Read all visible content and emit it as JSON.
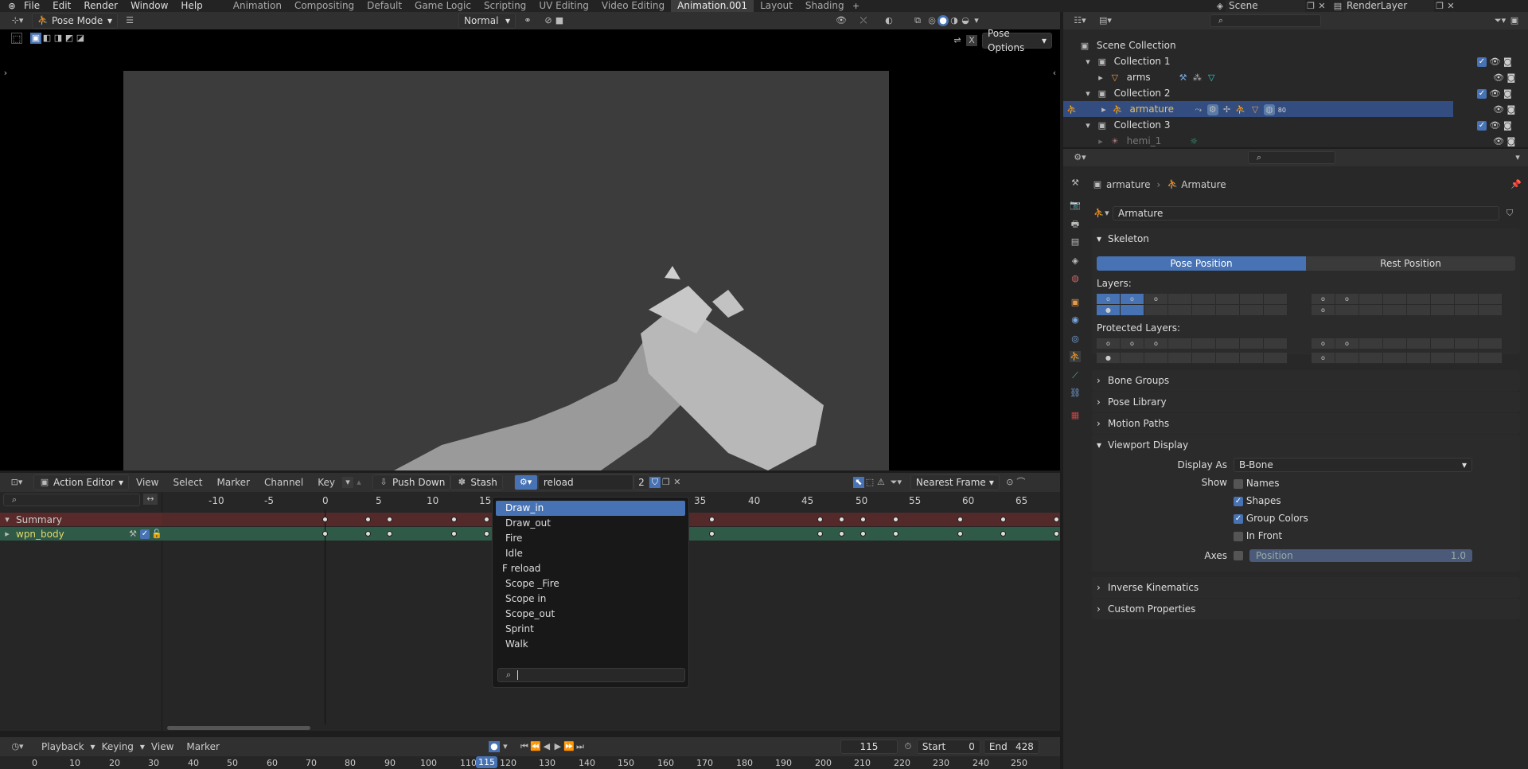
{
  "menu": {
    "items": [
      "File",
      "Edit",
      "Render",
      "Window",
      "Help"
    ]
  },
  "workspaces": {
    "tabs": [
      "Animation",
      "Compositing",
      "Default",
      "Game Logic",
      "Scripting",
      "UV Editing",
      "Video Editing",
      "Animation.001",
      "Layout",
      "Shading"
    ],
    "active": "Animation.001"
  },
  "scene": {
    "name": "Scene",
    "render_layer": "RenderLayer"
  },
  "viewport": {
    "mode": "Pose Mode",
    "transform": "Normal",
    "pose_options": "Pose Options"
  },
  "outliner": {
    "items": [
      {
        "label": "Scene Collection",
        "type": "scene"
      },
      {
        "label": "Collection 1",
        "type": "collection"
      },
      {
        "label": "arms",
        "type": "object"
      },
      {
        "label": "Collection 2",
        "type": "collection"
      },
      {
        "label": "armature",
        "type": "object",
        "selected": true
      },
      {
        "label": "Collection 3",
        "type": "collection"
      },
      {
        "label": "hemi_1",
        "type": "object",
        "dim": true
      }
    ],
    "badge": "80"
  },
  "properties": {
    "breadcrumb": {
      "object": "armature",
      "data": "Armature"
    },
    "datablock": "Armature",
    "skeleton": {
      "title": "Skeleton",
      "pose_position": "Pose Position",
      "rest_position": "Rest Position",
      "layers_label": "Layers:",
      "protected_label": "Protected Layers:"
    },
    "sections": [
      "Bone Groups",
      "Pose Library",
      "Motion Paths"
    ],
    "viewport_display": {
      "title": "Viewport Display",
      "display_as_label": "Display As",
      "display_as_value": "B-Bone",
      "show_label": "Show",
      "names": "Names",
      "shapes": "Shapes",
      "group_colors": "Group Colors",
      "in_front": "In Front",
      "axes_label": "Axes",
      "axes_field": "Position",
      "axes_value": "1.0"
    },
    "sections_bottom": [
      "Inverse Kinematics",
      "Custom Properties"
    ]
  },
  "action_editor": {
    "mode": "Action Editor",
    "menus": [
      "View",
      "Select",
      "Marker",
      "Channel",
      "Key"
    ],
    "push_down": "Push Down",
    "stash": "Stash",
    "action_name": "reload",
    "users": "2",
    "snap": "Nearest Frame",
    "ruler": [
      "-10",
      "-5",
      "0",
      "5",
      "10",
      "15",
      "35",
      "40",
      "45",
      "50",
      "55",
      "60",
      "65"
    ],
    "channels": [
      "Summary",
      "wpn_body"
    ],
    "dropdown": {
      "items": [
        "Draw_in",
        "Draw_out",
        "Fire",
        "Idle",
        "F reload",
        "Scope _Fire",
        "Scope in",
        "Scope_out",
        "Sprint",
        "Walk"
      ],
      "highlighted": "Draw_in"
    }
  },
  "timeline": {
    "menus": [
      "Playback",
      "Keying",
      "View",
      "Marker"
    ],
    "current_frame": "115",
    "start_label": "Start",
    "start": "0",
    "end_label": "End",
    "end": "428",
    "ruler": [
      "0",
      "10",
      "20",
      "30",
      "40",
      "50",
      "60",
      "70",
      "80",
      "90",
      "100",
      "110",
      "115",
      "120",
      "130",
      "140",
      "150",
      "160",
      "170",
      "180",
      "190",
      "200",
      "210",
      "220",
      "230",
      "240",
      "250"
    ]
  },
  "colors": {
    "accent": "#4772b3",
    "summary": "#5a2a2a",
    "channel": "#2e5a47",
    "channel_text": "#e4d96b"
  }
}
